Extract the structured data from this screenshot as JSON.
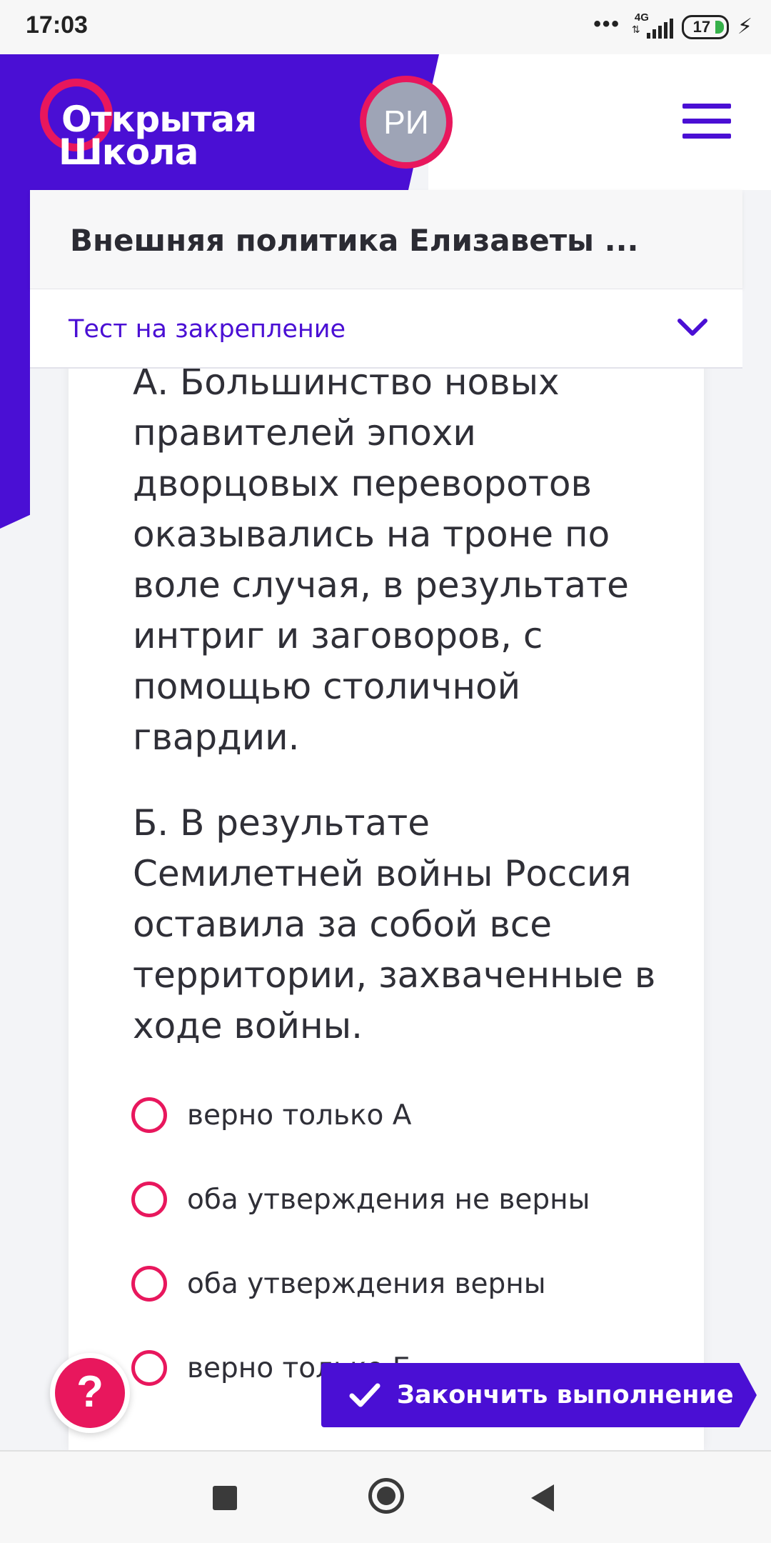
{
  "status_bar": {
    "time": "17:03",
    "more": "•••",
    "network": "4G",
    "battery": "17",
    "charging_icon": "bolt-icon"
  },
  "header": {
    "logo_line1": "Открытая",
    "logo_line2": "Школа",
    "avatar_initials": "РИ",
    "menu_icon": "hamburger-menu-icon"
  },
  "lesson": {
    "title": "Внешняя политика Елизаветы ...",
    "section_select": "Тест на закрепление"
  },
  "question": {
    "statement_a": "А. Большинство новых правителей эпохи дворцовых переворотов оказывались на троне по воле случая, в результате интриг и заговоров, с помощью столичной гвардии.",
    "statement_b": "Б. В результате Семилетней войны Россия оставила за собой все территории, захваченные в ходе войны.",
    "options": [
      "верно только А",
      "оба утверждения не верны",
      "оба утверждения верны",
      "верно только Б"
    ]
  },
  "actions": {
    "help_label": "?",
    "finish_label": "Закончить выполнение"
  },
  "colors": {
    "brand_purple": "#4a0fd4",
    "accent_pink": "#e8175d",
    "avatar_gray": "#9ea4b6"
  }
}
